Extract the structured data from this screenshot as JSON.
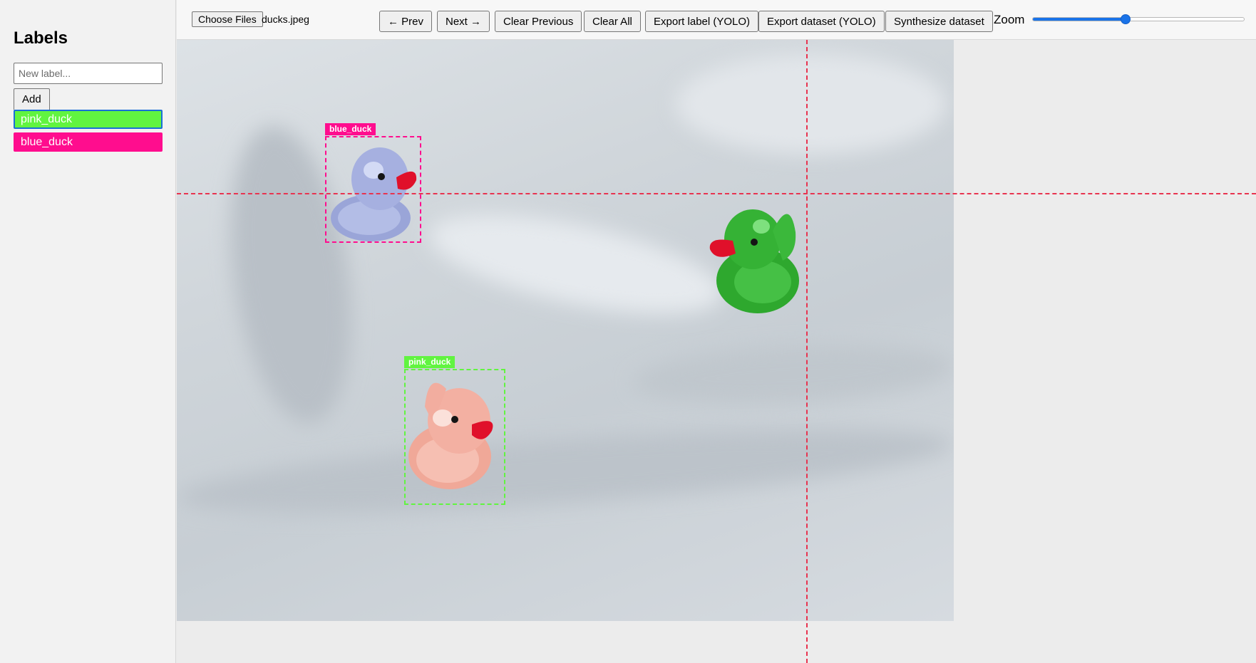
{
  "sidebar": {
    "title": "Labels",
    "new_label_placeholder": "New label...",
    "add_label": "Add",
    "labels": [
      {
        "name": "pink_duck",
        "color": "#61f440",
        "selected": true
      },
      {
        "name": "blue_duck",
        "color": "#ff0d8e",
        "selected": false
      }
    ]
  },
  "toolbar": {
    "choose_files": "Choose Files",
    "file_name": "ducks.jpeg",
    "prev": "← Prev",
    "next": "Next →",
    "clear_previous": "Clear Previous",
    "clear_all": "Clear All",
    "export_label": "Export label (YOLO)",
    "export_dataset": "Export dataset (YOLO)",
    "synthesize": "Synthesize dataset",
    "zoom_label": "Zoom",
    "zoom_value": 0.44
  },
  "annotations": [
    {
      "label": "blue_duck",
      "color": "#ff0d8e"
    },
    {
      "label": "pink_duck",
      "color": "#61f440"
    }
  ],
  "crosshair_color": "#e8334f",
  "accent_color": "#1a73e8"
}
